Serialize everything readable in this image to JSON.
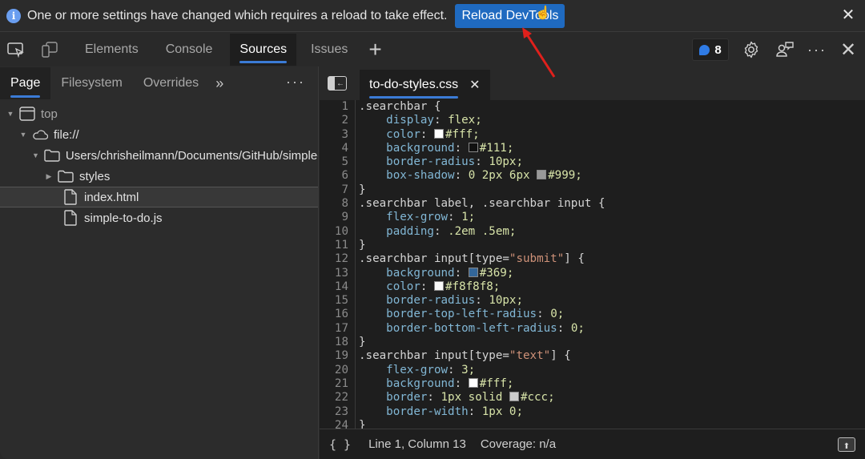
{
  "banner": {
    "message": "One or more settings have changed which requires a reload to take effect.",
    "reload_label": "Reload DevTools",
    "close_icon": "close-icon",
    "info_icon": "info-icon"
  },
  "toolbar": {
    "tabs": [
      {
        "label": "Elements",
        "active": false
      },
      {
        "label": "Console",
        "active": false
      },
      {
        "label": "Sources",
        "active": true
      },
      {
        "label": "Issues",
        "active": false
      }
    ],
    "add_tab_label": "+",
    "issues_count": "8",
    "icons": [
      "inspect-icon",
      "device-emulation-icon",
      "settings-icon",
      "feedback-icon",
      "more-icon",
      "close-icon"
    ]
  },
  "navigator": {
    "tabs": [
      {
        "label": "Page",
        "active": true
      },
      {
        "label": "Filesystem",
        "active": false
      },
      {
        "label": "Overrides",
        "active": false
      }
    ],
    "more_tabs_label": "»",
    "tree": [
      {
        "label": "top",
        "type": "frame",
        "expanded": true,
        "depth": 0
      },
      {
        "label": "file://",
        "type": "cloud",
        "expanded": true,
        "depth": 1
      },
      {
        "label": "Users/chrisheilmann/Documents/GitHub/simple-to-do",
        "type": "folder",
        "expanded": true,
        "depth": 2
      },
      {
        "label": "styles",
        "type": "folder",
        "expanded": false,
        "depth": 3
      },
      {
        "label": "index.html",
        "type": "file",
        "depth": 3,
        "selected": true
      },
      {
        "label": "simple-to-do.js",
        "type": "file",
        "depth": 3
      }
    ]
  },
  "editor": {
    "open_file": "to-do-styles.css",
    "lines": [
      {
        "n": "1",
        "text": ".searchbar {"
      },
      {
        "n": "2",
        "text": "    display: flex;"
      },
      {
        "n": "3",
        "text": "    color: #fff;",
        "swatch": "#ffffff"
      },
      {
        "n": "4",
        "text": "    background: #111;",
        "swatch": "#111111"
      },
      {
        "n": "5",
        "text": "    border-radius: 10px;"
      },
      {
        "n": "6",
        "text": "    box-shadow: 0 2px 6px #999;",
        "swatch": "#999999"
      },
      {
        "n": "7",
        "text": "}"
      },
      {
        "n": "8",
        "text": ".searchbar label, .searchbar input {"
      },
      {
        "n": "9",
        "text": "    flex-grow: 1;"
      },
      {
        "n": "10",
        "text": "    padding: .2em .5em;"
      },
      {
        "n": "11",
        "text": "}"
      },
      {
        "n": "12",
        "text": ".searchbar input[type=\"submit\"] {"
      },
      {
        "n": "13",
        "text": "    background: #369;",
        "swatch": "#336699"
      },
      {
        "n": "14",
        "text": "    color: #f8f8f8;",
        "swatch": "#f8f8f8"
      },
      {
        "n": "15",
        "text": "    border-radius: 10px;"
      },
      {
        "n": "16",
        "text": "    border-top-left-radius: 0;"
      },
      {
        "n": "17",
        "text": "    border-bottom-left-radius: 0;"
      },
      {
        "n": "18",
        "text": "}"
      },
      {
        "n": "19",
        "text": ".searchbar input[type=\"text\"] {"
      },
      {
        "n": "20",
        "text": "    flex-grow: 3;"
      },
      {
        "n": "21",
        "text": "    background: #fff;",
        "swatch": "#ffffff"
      },
      {
        "n": "22",
        "text": "    border: 1px solid #ccc;",
        "swatch": "#cccccc"
      },
      {
        "n": "23",
        "text": "    border-width: 1px 0;"
      },
      {
        "n": "24",
        "text": "}"
      }
    ],
    "status": {
      "pretty_print_label": "{ }",
      "position": "Line 1, Column 13",
      "coverage": "Coverage: n/a"
    }
  },
  "colors": {
    "accent": "#3b7bd6",
    "reload_button": "#1f6ac0",
    "annotation_arrow": "#e0201c"
  }
}
